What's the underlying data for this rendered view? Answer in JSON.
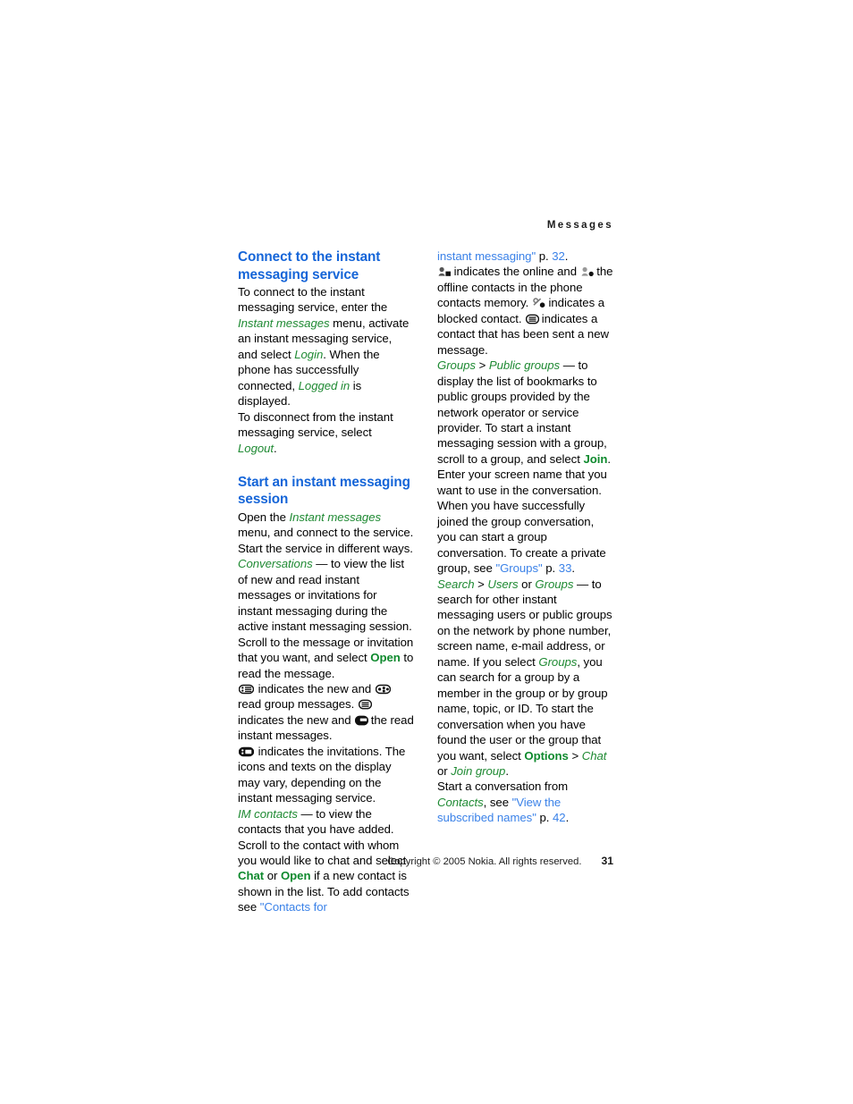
{
  "document": {
    "running_header": "Messages",
    "page_number": "31",
    "copyright": "Copyright © 2005 Nokia. All rights reserved."
  },
  "colors": {
    "heading_blue": "#1565d8",
    "link_blue": "#3b82e8",
    "italic_green": "#1f8a33",
    "bold_green": "#0f8a2e",
    "body_black": "#000000"
  },
  "left_column": {
    "heading_1": "Connect to the instant messaging service",
    "para_1": {
      "t1": "To connect to the instant messaging service, enter the ",
      "em1": "Instant messages",
      "t2": " menu, activate an instant messaging service, and select ",
      "em2": "Login",
      "t3": ". When the phone has successfully connected, ",
      "em3": "Logged in",
      "t4": " is displayed."
    },
    "para_2": {
      "t1": "To disconnect from the instant messaging service, select ",
      "em1": "Logout",
      "t2": "."
    },
    "heading_2": "Start an instant messaging session",
    "para_3": {
      "t1": "Open the ",
      "em1": "Instant messages",
      "t2": " menu, and connect to the service. Start the service in different ways."
    },
    "para_4": {
      "em1": "Conversations",
      "t1": " — to view the list of new and read instant messages or invitations for instant messaging during the active instant messaging session. Scroll to the message or invitation that you want, and select ",
      "b1": "Open",
      "t2": " to read the message."
    },
    "para_5": {
      "t1": " indicates the new and ",
      "t2": " read group messages. ",
      "t3": " indicates the new and ",
      "t4": " the read instant messages."
    },
    "para_6": {
      "t1": " indicates the invitations. The icons and texts on the display may vary, depending on the instant messaging service."
    },
    "para_7": {
      "em1": "IM contacts",
      "t1": " — to view the contacts that you have added. Scroll to the contact with whom you would like to chat and select ",
      "b1": "Chat",
      "t2": " or ",
      "b2": "Open",
      "t3": " if a new contact is shown in the list. To add contacts see ",
      "link1": "\"Contacts for"
    }
  },
  "right_column": {
    "para_1": {
      "link1": "instant messaging\"",
      "t1": " p. ",
      "link2": "32",
      "t2": "."
    },
    "para_2": {
      "t1": " indicates the online and ",
      "t2": " the offline contacts in the phone contacts memory. ",
      "t3": " indicates a blocked contact. ",
      "t4": " indicates a contact that has been sent a new message."
    },
    "para_3": {
      "em1": "Groups",
      "sep1": " > ",
      "em2": "Public groups",
      "t1": " — to display the list of bookmarks to public groups provided by the network operator or service provider. To start a instant messaging session with a group, scroll to a group, and select ",
      "b1": "Join",
      "t2": ". Enter your screen name that you want to use in the conversation. When you have successfully joined the group conversation, you can start a group conversation. To create a private group, see ",
      "link1": "\"Groups\"",
      "t3": " p. ",
      "link2": "33",
      "t4": "."
    },
    "para_4": {
      "em1": "Search",
      "sep1": " > ",
      "em2": "Users",
      "t1": " or ",
      "em3": "Groups",
      "t2": " — to search for other instant messaging users or public groups on the network by phone number, screen name, e-mail address, or name. If you select ",
      "em4": "Groups",
      "t3": ", you can search for a group by a member in the group or by group name, topic, or ID. To start the conversation when you have found the user or the group that you want, select ",
      "b1": "Options",
      "t4": " > ",
      "em5": "Chat",
      "t5": " or ",
      "em6": "Join group",
      "t6": "."
    },
    "para_5": {
      "t1": "Start a conversation from ",
      "em1": "Contacts",
      "t2": ", see ",
      "link1": "\"View the subscribed names\"",
      "t3": " p. ",
      "link2": "42",
      "t4": "."
    }
  },
  "icons": {
    "new_group_message": "new-group-message-icon",
    "read_group_message": "read-group-message-icon",
    "new_instant_message": "new-instant-message-icon",
    "read_instant_message": "read-instant-message-icon",
    "invitation": "invitation-icon",
    "online_contact": "online-contact-icon",
    "offline_contact": "offline-contact-icon",
    "blocked_contact": "blocked-contact-icon",
    "sent_new_message": "sent-new-message-icon"
  }
}
